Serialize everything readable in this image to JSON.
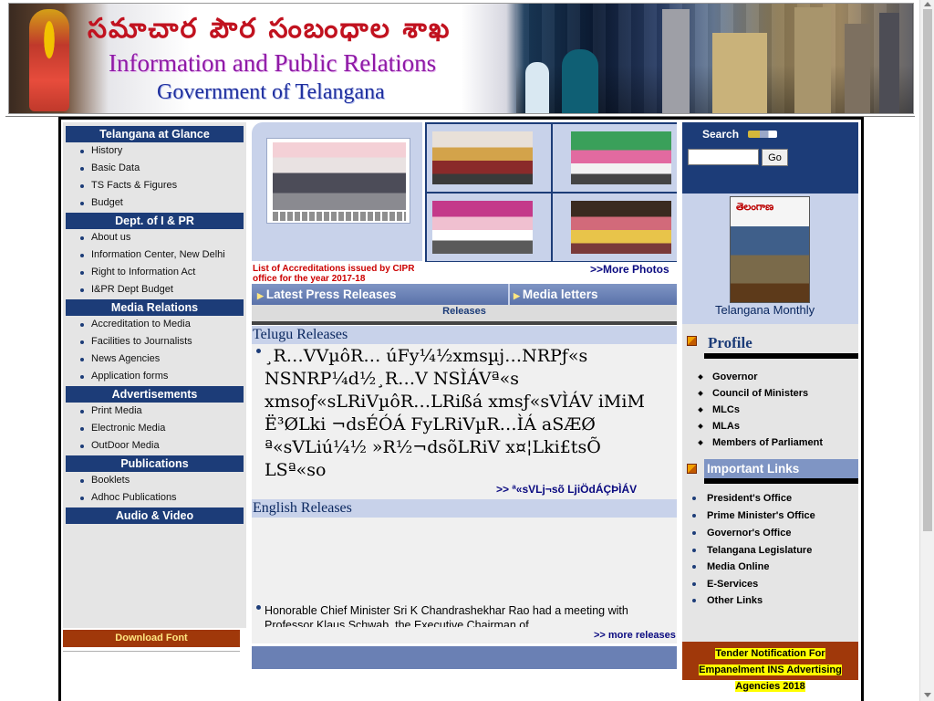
{
  "banner": {
    "telugu_title": "సమాచార పౌర సంబంధాల శాఖ",
    "english_line1": "Information and Public Relations",
    "english_line2": "Government of Telangana"
  },
  "left_menu": {
    "sections": [
      {
        "title": "Telangana at Glance",
        "items": [
          "History",
          "Basic Data",
          "TS Facts & Figures",
          "Budget"
        ]
      },
      {
        "title": "Dept. of I & PR",
        "items": [
          "About us",
          "Information Center, New Delhi",
          "Right to Information Act",
          "I&PR Dept Budget"
        ]
      },
      {
        "title": "Media Relations",
        "items": [
          "Accreditation to Media",
          "Facilities to Journalists",
          "News Agencies",
          "Application forms"
        ]
      },
      {
        "title": "Advertisements",
        "items": [
          "Print Media",
          "Electronic Media",
          "OutDoor Media"
        ]
      },
      {
        "title": "Publications",
        "items": [
          "Booklets",
          "Adhoc Publications"
        ]
      },
      {
        "title": "Audio & Video",
        "items": []
      }
    ],
    "download_font": "Download Font"
  },
  "center": {
    "accreditation_link": "List of Accreditations issued by CIPR office for the year 2017-18",
    "more_photos": ">>More Photos",
    "tabs": [
      "Latest Press Releases",
      "Media letters"
    ],
    "releases_sub": "Releases",
    "telugu_releases_title": "Telugu Releases",
    "telugu_release_text": "¸R…VVµôR… úFy¼½xmsµj…NRPƒ«s NSNRP¼d½¸R…V NSÌÁVª«s xmsoƒ«sLRiVµôR…LRißá xmsƒ«sVÌÁV iMiM Ë³ØLki ¬dsÉÓÁ FyLRiVµR…ÌÁ aSÆØ ª«sVLiú¼½ »R½¬dsõLRiV x¤¦Lki£tsÕ LSª«so",
    "telugu_more": ">> ª«sVLj¬sõ LjiÖdÁÇÞÌÁV",
    "english_releases_title": "English Releases",
    "english_release_text": "Honorable Chief Minister Sri K Chandrashekhar Rao had a meeting with Professor Klaus Schwab, the Executive Chairman of",
    "english_more": ">> more releases"
  },
  "right": {
    "search_label": "Search",
    "search_value": "",
    "go_label": "Go",
    "magazine_title": "తెలంగాణ",
    "magazine_caption": "Telangana   Monthly",
    "profile_title": "Profile",
    "profile_items": [
      "Governor",
      "Council of Ministers",
      "MLCs",
      "MLAs",
      "Members of  Parliament"
    ],
    "important_links_title": "Important Links",
    "important_links": [
      "President's Office",
      "Prime Minister's Office",
      "Governor's Office",
      "Telangana Legislature",
      "Media Online",
      "E-Services",
      "Other Links"
    ],
    "tender_text": "Tender Notification For Empanelment INS Advertising Agencies 2018"
  },
  "colors": {
    "nav_blue": "#1c3c78",
    "tab_blue": "#7f95c4",
    "light_blue": "#c8d2ea",
    "rust": "#a0380a",
    "link_red": "#cc0000"
  }
}
